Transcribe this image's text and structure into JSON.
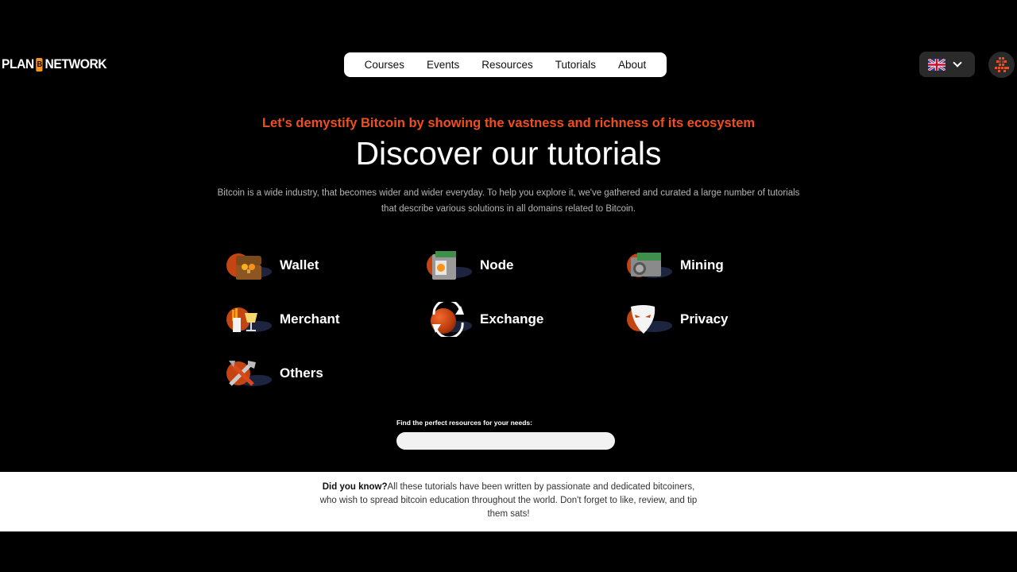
{
  "header": {
    "logo_left": "PLAN",
    "logo_mid": "B",
    "logo_right": "NETWORK",
    "nav": [
      "Courses",
      "Events",
      "Resources",
      "Tutorials",
      "About"
    ]
  },
  "hero": {
    "tagline": "Let's demystify Bitcoin by showing the vastness and richness of its ecosystem",
    "title": "Discover our tutorials",
    "description": "Bitcoin is a wide industry, that becomes wider and wider everyday. To help you explore it, we've gathered and curated a large number of tutorials that describe various solutions in all domains related to Bitcoin."
  },
  "categories": [
    "Wallet",
    "Node",
    "Mining",
    "Merchant",
    "Exchange",
    "Privacy",
    "Others"
  ],
  "search": {
    "label": "Find the perfect resources for your needs:",
    "placeholder": ""
  },
  "footer": {
    "bold": "Did you know?",
    "text": "All these tutorials have been written by passionate and dedicated bitcoiners, who wish to spread bitcoin education throughout the world. Don't forget to like, review, and tip them sats!"
  },
  "colors": {
    "accent": "#f04e1e",
    "bitcoin": "#f7931a"
  }
}
